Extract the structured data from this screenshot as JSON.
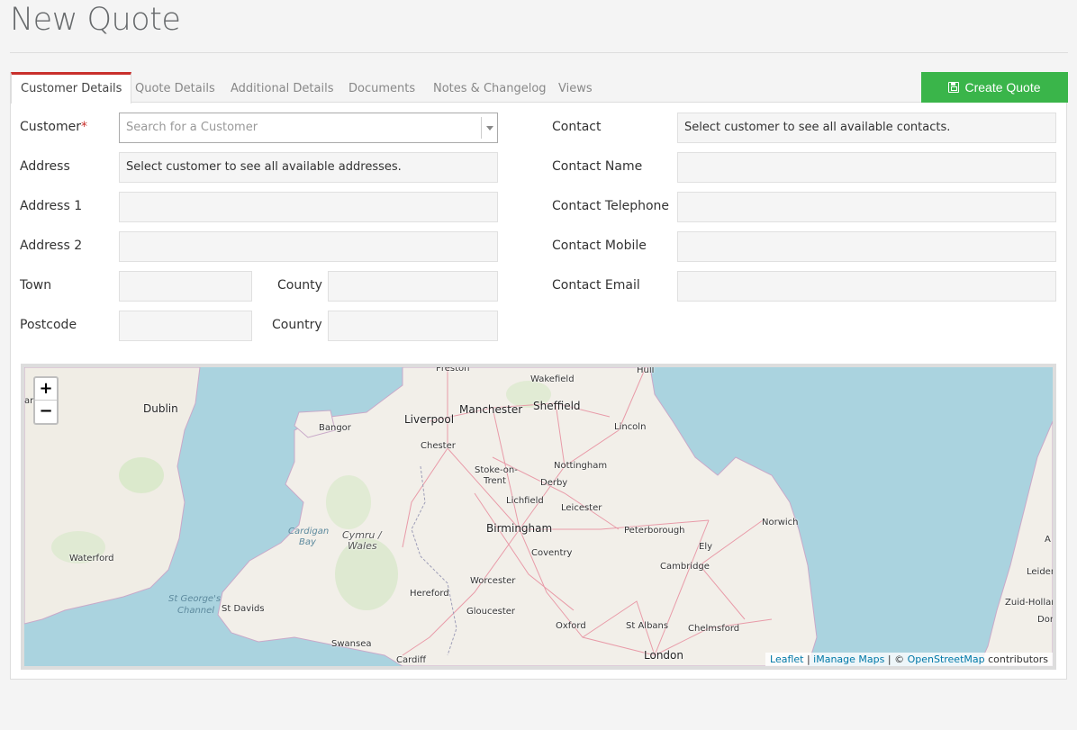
{
  "page": {
    "title": "New Quote"
  },
  "tabs": [
    {
      "label": "Customer Details",
      "active": true
    },
    {
      "label": "Quote Details",
      "active": false
    },
    {
      "label": "Additional Details",
      "active": false
    },
    {
      "label": "Documents",
      "active": false
    },
    {
      "label": "Notes & Changelog",
      "active": false
    },
    {
      "label": "Views",
      "active": false
    }
  ],
  "actions": {
    "create_quote_label": "Create Quote",
    "create_quote_icon": "save-icon",
    "accent_color": "#3ab54a"
  },
  "form": {
    "customer": {
      "label": "Customer",
      "required_marker": "*",
      "placeholder": "Search for a Customer"
    },
    "address": {
      "label": "Address",
      "value": "Select customer to see all available addresses."
    },
    "address1": {
      "label": "Address 1",
      "value": ""
    },
    "address2": {
      "label": "Address 2",
      "value": ""
    },
    "town": {
      "label": "Town",
      "value": ""
    },
    "county": {
      "label": "County",
      "value": ""
    },
    "postcode": {
      "label": "Postcode",
      "value": ""
    },
    "country": {
      "label": "Country",
      "value": ""
    },
    "contact": {
      "label": "Contact",
      "value": "Select customer to see all available contacts."
    },
    "contact_name": {
      "label": "Contact Name",
      "value": ""
    },
    "contact_telephone": {
      "label": "Contact Telephone",
      "value": ""
    },
    "contact_mobile": {
      "label": "Contact Mobile",
      "value": ""
    },
    "contact_email": {
      "label": "Contact Email",
      "value": ""
    }
  },
  "map": {
    "zoom_in": "+",
    "zoom_out": "−",
    "attribution": {
      "leaflet": "Leaflet",
      "sep1": " | ",
      "imanage": "iManage Maps",
      "sep2": " | © ",
      "osm": "OpenStreetMap",
      "suffix": " contributors"
    },
    "places": {
      "preston": "Preston",
      "hull": "Hull",
      "wakefield": "Wakefield",
      "manchester": "Manchester",
      "sheffield": "Sheffield",
      "liverpool": "Liverpool",
      "dublin": "Dublin",
      "bangor": "Bangor",
      "lincoln": "Lincoln",
      "chester": "Chester",
      "stoke1": "Stoke-on-",
      "stoke2": "Trent",
      "nottingham": "Nottingham",
      "derby": "Derby",
      "lichfield": "Lichfield",
      "leicester": "Leicester",
      "norwich": "Norwich",
      "cardigan1": "Cardigan",
      "cardigan2": "Bay",
      "cymru1": "Cymru /",
      "cymru2": "Wales",
      "birmingham": "Birmingham",
      "peterborough": "Peterborough",
      "ely": "Ely",
      "waterford": "Waterford",
      "coventry": "Coventry",
      "cambridge": "Cambridge",
      "leiden": "Leiden",
      "worcester": "Worcester",
      "stgeorges1": "St George's",
      "stgeorges2": "Channel",
      "hereford": "Hereford",
      "zuid": "Zuid-Hollar",
      "stdavids": "St Davids",
      "gloucester": "Gloucester",
      "dor": "Dor",
      "oxford": "Oxford",
      "stalbans": "St Albans",
      "chelmsford": "Chelmsford",
      "swansea": "Swansea",
      "london": "London",
      "cardiff": "Cardiff",
      "a_edge": "A",
      "ar_edge": "ar"
    }
  }
}
